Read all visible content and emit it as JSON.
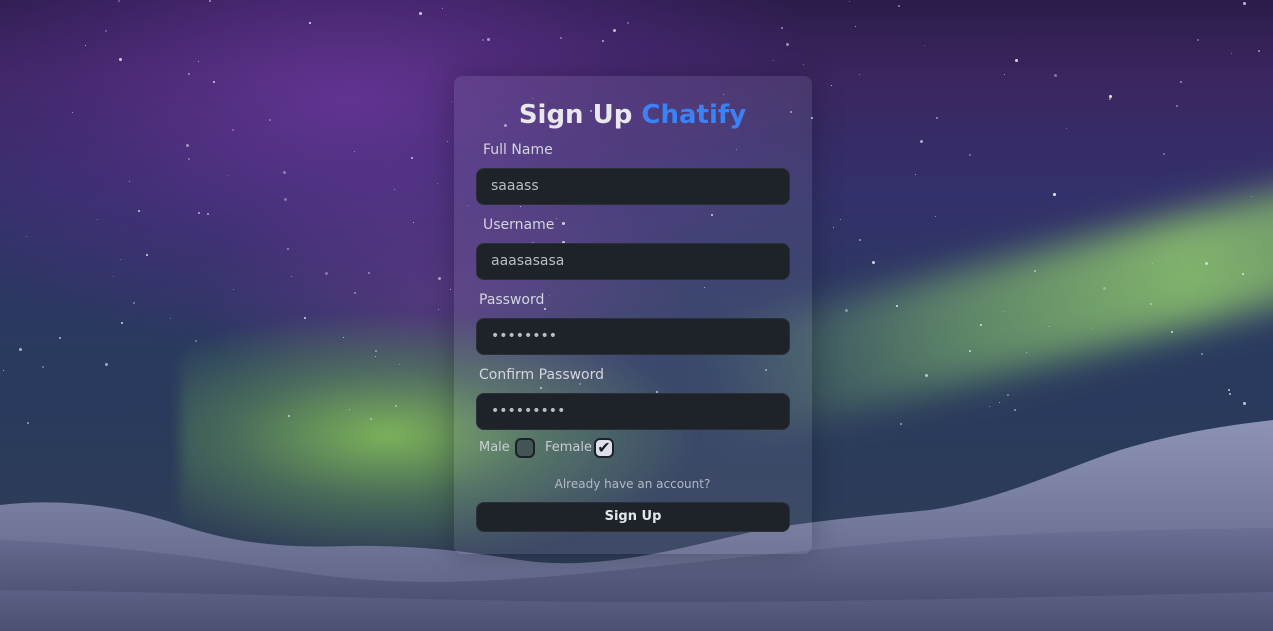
{
  "form": {
    "title_main": "Sign Up",
    "title_brand": "Chatify",
    "fullname": {
      "label": "Full Name",
      "value": "saaass"
    },
    "username": {
      "label": "Username",
      "value": "aaasasasa"
    },
    "password": {
      "label": "Password",
      "value": "••••••••"
    },
    "confirm_password": {
      "label": "Confirm Password",
      "value": "•••••••••"
    },
    "gender": {
      "male_label": "Male",
      "female_label": "Female",
      "male_checked": false,
      "female_checked": true
    },
    "login_link": "Already have an account?",
    "submit_label": "Sign Up"
  },
  "theme": {
    "brand_color": "#3b82f6",
    "input_bg": "#1e2229"
  }
}
